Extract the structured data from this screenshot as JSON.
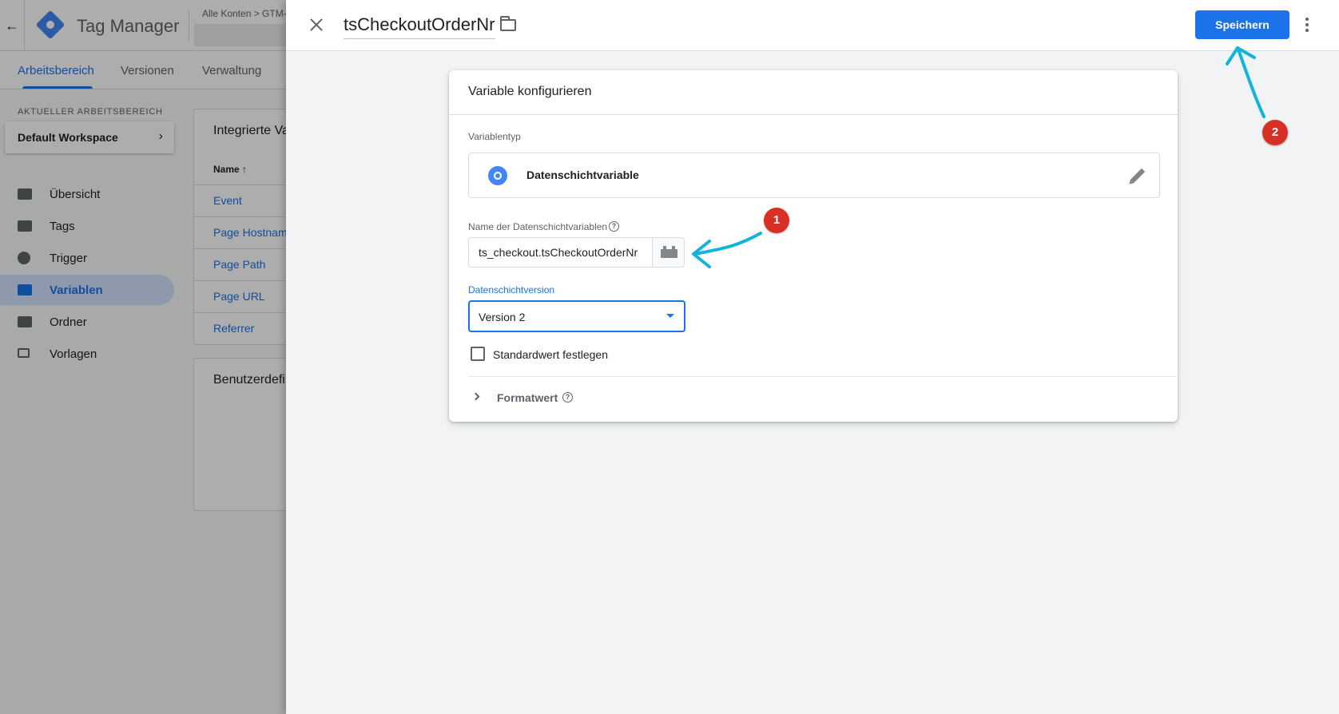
{
  "app": {
    "title": "Tag Manager",
    "breadcrumb": "Alle Konten > GTM-",
    "nav_tabs": [
      "Arbeitsbereich",
      "Versionen",
      "Verwaltung"
    ],
    "workspace_label": "AKTUELLER ARBEITSBEREICH",
    "workspace_name": "Default Workspace",
    "sidebar": [
      {
        "label": "Übersicht",
        "icon": "overview-icon"
      },
      {
        "label": "Tags",
        "icon": "tag-icon"
      },
      {
        "label": "Trigger",
        "icon": "trigger-icon"
      },
      {
        "label": "Variablen",
        "icon": "variables-icon",
        "active": true
      },
      {
        "label": "Ordner",
        "icon": "folder-icon"
      },
      {
        "label": "Vorlagen",
        "icon": "template-icon"
      }
    ],
    "builtin_card": {
      "title": "Integrierte Variablen",
      "column": "Name",
      "rows": [
        "Event",
        "Page Hostname",
        "Page Path",
        "Page URL",
        "Referrer"
      ]
    },
    "custom_card_title": "Benutzerdefinierte Variablen"
  },
  "sheet": {
    "variable_name": "tsCheckoutOrderNr",
    "save_label": "Speichern",
    "card_title": "Variable konfigurieren",
    "variable_type_label": "Variablentyp",
    "variable_type": "Datenschichtvariable",
    "dl_name_label": "Name der Datenschichtvariablen",
    "dl_name_value": "ts_checkout.tsCheckoutOrderNr",
    "version_label": "Datenschichtversion",
    "version_value": "Version 2",
    "default_label": "Standardwert festlegen",
    "format_label": "Formatwert"
  },
  "annotations": {
    "badge1": "1",
    "badge2": "2"
  },
  "colors": {
    "accent": "#1a73e8",
    "badge": "#d93025",
    "arrow": "#14b3d8"
  }
}
